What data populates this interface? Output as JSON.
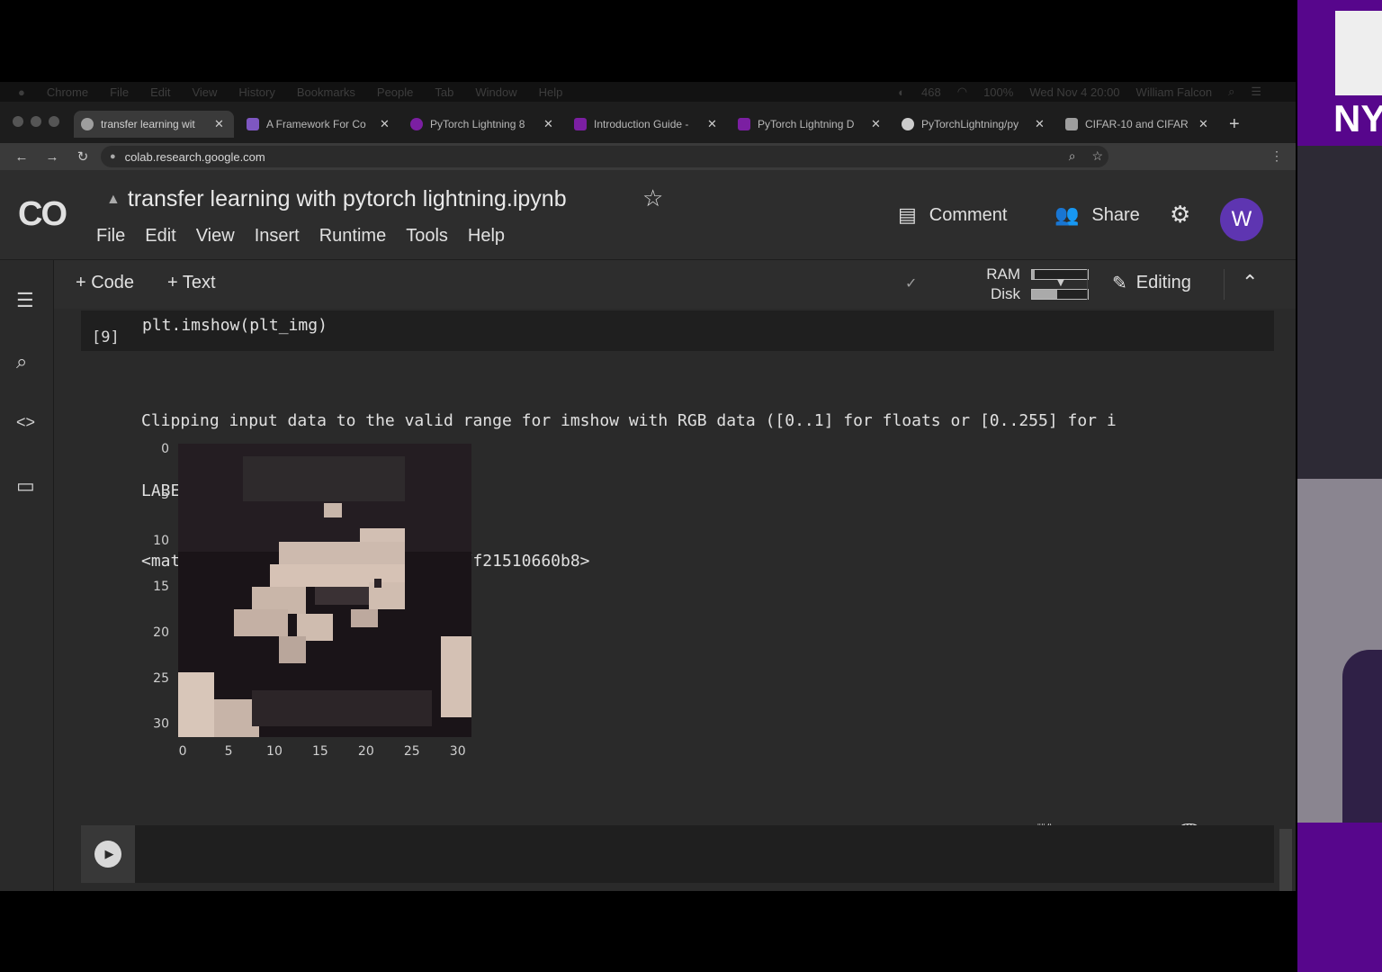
{
  "mac_menubar": {
    "items": [
      "Chrome",
      "File",
      "Edit",
      "View",
      "History",
      "Bookmarks",
      "People",
      "Tab",
      "Window",
      "Help"
    ],
    "status": [
      "468",
      "100%",
      "Wed Nov 4  20:00",
      "William Falcon"
    ]
  },
  "browser": {
    "tabs": [
      {
        "label": "transfer learning wit",
        "active": true,
        "color": "#9e9e9e"
      },
      {
        "label": "A Framework For Co",
        "active": false,
        "color": "#7e57c2"
      },
      {
        "label": "PyTorch Lightning 8",
        "active": false,
        "color": "#7b1fa2"
      },
      {
        "label": "Introduction Guide -",
        "active": false,
        "color": "#7b1fa2"
      },
      {
        "label": "PyTorch Lightning D",
        "active": false,
        "color": "#7b1fa2"
      },
      {
        "label": "PyTorchLightning/py",
        "active": false,
        "color": "#cccccc"
      },
      {
        "label": "CIFAR-10 and CIFAR",
        "active": false,
        "color": "#9e9e9e"
      }
    ],
    "url": "colab.research.google.com",
    "new_tab": "+"
  },
  "colab": {
    "logo": "CO",
    "notebook_title": "transfer learning with pytorch lightning.ipynb",
    "menu": [
      "File",
      "Edit",
      "View",
      "Insert",
      "Runtime",
      "Tools",
      "Help"
    ],
    "comment_label": "Comment",
    "share_label": "Share",
    "avatar_letter": "W"
  },
  "toolbar": {
    "add_code": "+ Code",
    "add_text": "+ Text",
    "ram_label": "RAM",
    "disk_label": "Disk",
    "ram_fraction": 0.05,
    "disk_fraction": 0.45,
    "editing_label": "Editing"
  },
  "cell": {
    "exec_count": "[9]",
    "code": "plt.imshow(plt_img)",
    "output_lines": [
      "Clipping input data to the valid range for imshow with RGB data ([0..1] for floats or [0..255] for i",
      "LABEL: 6",
      "<matplotlib.image.AxesImage at 0x7f21510660b8>"
    ]
  },
  "plot": {
    "x_ticks": [
      "0",
      "5",
      "10",
      "15",
      "20",
      "25",
      "30"
    ],
    "y_ticks": [
      "0",
      "5",
      "10",
      "15",
      "20",
      "25",
      "30"
    ]
  },
  "strip": {
    "nyu_text": "NY"
  }
}
